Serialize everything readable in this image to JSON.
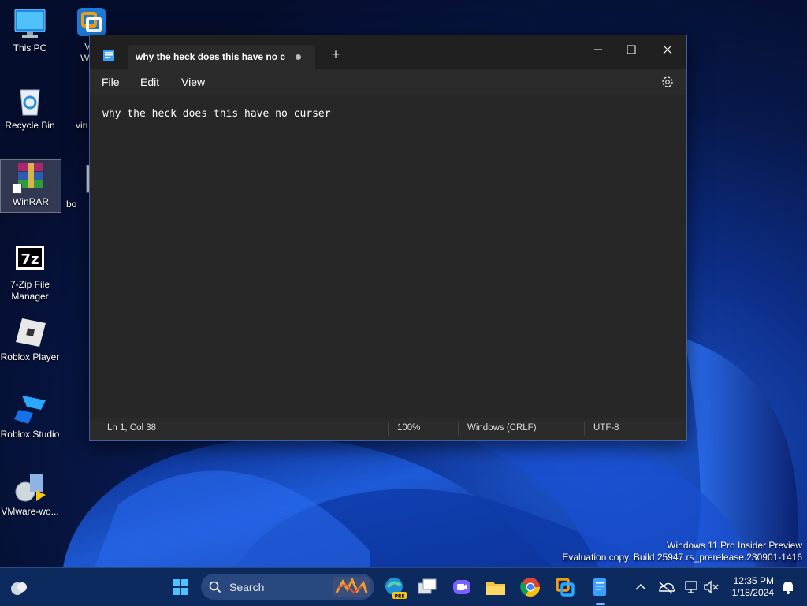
{
  "desktop": {
    "icons": [
      {
        "label": "This PC"
      },
      {
        "label": "VMware Workstation",
        "short": "VM\nWork"
      },
      {
        "label": "Recycle Bin"
      },
      {
        "label": "virus"
      },
      {
        "label": "WinRAR"
      },
      {
        "label": "bo"
      },
      {
        "label": "7-Zip File Manager"
      },
      {
        "label": "Roblox Player"
      },
      {
        "label": "Roblox Studio"
      },
      {
        "label": "VMware-wo..."
      }
    ]
  },
  "notepad": {
    "tab_title": "why the heck does this have no cur",
    "unsaved_indicator": "●",
    "new_tab": "+",
    "menu": {
      "file": "File",
      "edit": "Edit",
      "view": "View"
    },
    "content": "why the heck does this have no curser",
    "status": {
      "position": "Ln 1, Col 38",
      "zoom": "100%",
      "line_ending": "Windows (CRLF)",
      "encoding": "UTF-8"
    }
  },
  "watermark": {
    "line1": "Windows 11 Pro Insider Preview",
    "line2": "Evaluation copy. Build 25947.rs_prerelease.230901-1416"
  },
  "taskbar": {
    "search_placeholder": "Search",
    "pinned": [
      "start-icon",
      "search",
      "edge-beta-icon",
      "task-view-icon",
      "teams-chat-icon",
      "file-explorer-icon",
      "chrome-icon",
      "vmware-icon",
      "notepad-icon"
    ],
    "clock": {
      "time": "12:35 PM",
      "date": "1/18/2024"
    }
  },
  "colors": {
    "accent": "#0078d4",
    "window_bg": "#202020",
    "editor_bg": "#272727"
  }
}
